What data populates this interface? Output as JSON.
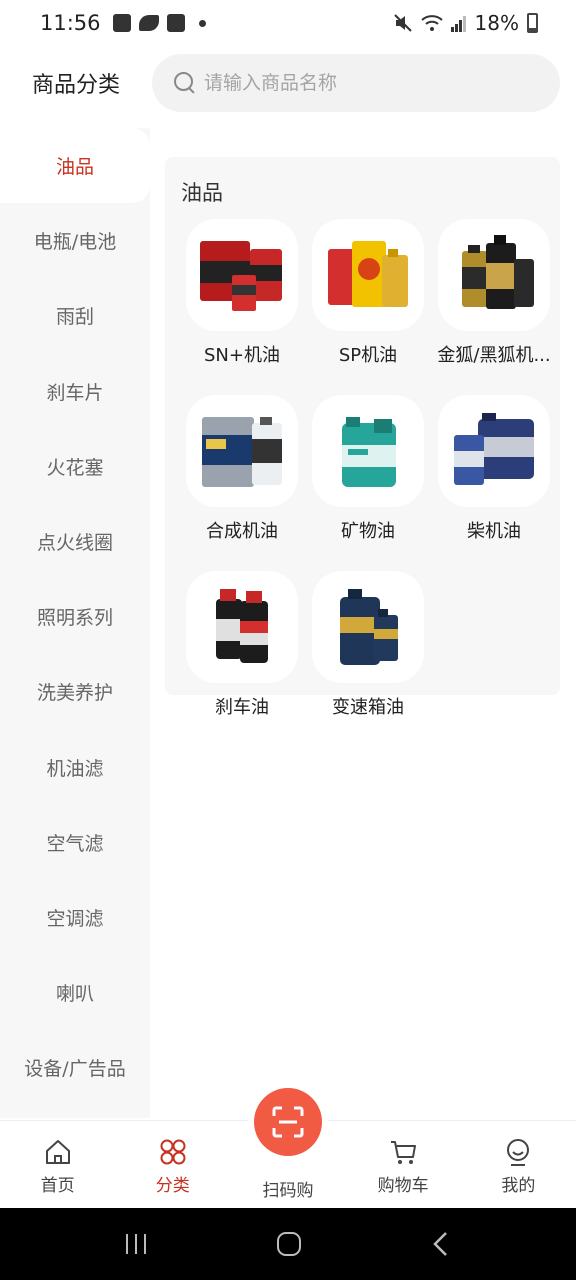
{
  "status_bar": {
    "time": "11:56",
    "battery": "18%"
  },
  "header": {
    "title": "商品分类"
  },
  "search": {
    "placeholder": "请输入商品名称"
  },
  "sidebar": {
    "items": [
      {
        "label": "油品",
        "active": true
      },
      {
        "label": "电瓶/电池"
      },
      {
        "label": "雨刮"
      },
      {
        "label": "刹车片"
      },
      {
        "label": "火花塞"
      },
      {
        "label": "点火线圈"
      },
      {
        "label": "照明系列"
      },
      {
        "label": "洗美养护"
      },
      {
        "label": "机油滤"
      },
      {
        "label": "空气滤"
      },
      {
        "label": "空调滤"
      },
      {
        "label": "喇叭"
      },
      {
        "label": "设备/广告品"
      }
    ]
  },
  "panel": {
    "title": "油品",
    "products": [
      {
        "name": "SN+机油"
      },
      {
        "name": "SP机油"
      },
      {
        "name": "金狐/黑狐机..."
      },
      {
        "name": "合成机油"
      },
      {
        "name": "矿物油"
      },
      {
        "name": "柴机油"
      },
      {
        "name": "刹车油"
      },
      {
        "name": "变速箱油"
      }
    ]
  },
  "bottom_nav": {
    "home": "首页",
    "category": "分类",
    "scan": "扫码购",
    "cart": "购物车",
    "mine": "我的"
  },
  "colors": {
    "accent": "#c8321f",
    "scan": "#f15a43"
  }
}
